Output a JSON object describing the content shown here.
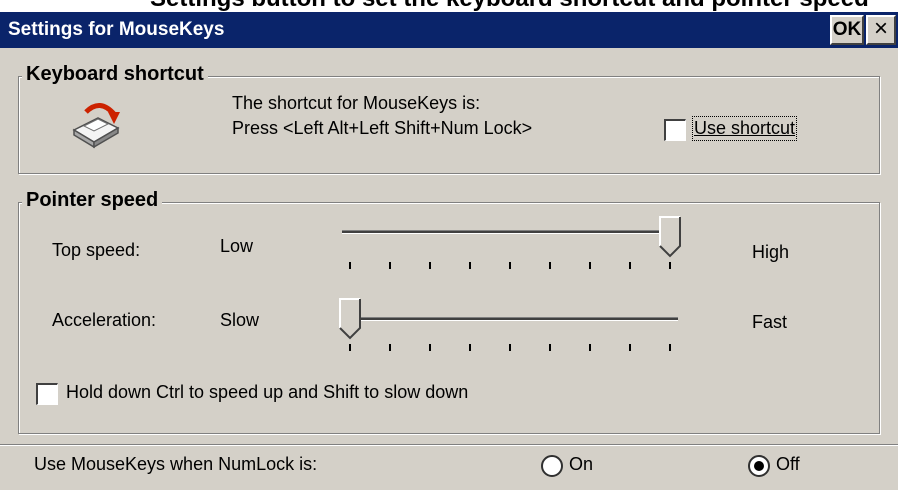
{
  "top_strip": {
    "text": "Settings button to set the keyboard shortcut and pointer speed"
  },
  "title_bar": {
    "title": "Settings for MouseKeys",
    "ok_label": "OK",
    "close_label": "×"
  },
  "keyboard_shortcut": {
    "legend": "Keyboard shortcut",
    "line1": "The shortcut for MouseKeys is:",
    "line2": "Press <Left Alt+Left Shift+Num Lock>",
    "checkbox_label": "Use shortcut",
    "checkbox_checked": false
  },
  "pointer_speed": {
    "legend": "Pointer speed",
    "top_speed": {
      "label": "Top speed:",
      "min_label": "Low",
      "max_label": "High",
      "value_fraction": 1.0
    },
    "acceleration": {
      "label": "Acceleration:",
      "min_label": "Slow",
      "max_label": "Fast",
      "value_fraction": 0.0
    },
    "hold_ctrl_label": "Hold down Ctrl to speed up and Shift to slow down",
    "hold_ctrl_checked": false
  },
  "numlock": {
    "label": "Use MouseKeys when NumLock is:",
    "options": [
      {
        "label": "On",
        "selected": false
      },
      {
        "label": "Off",
        "selected": true
      }
    ]
  },
  "colors": {
    "title_bar": "#0a246a",
    "face": "#d4d0c8",
    "shortcut_arrow": "#cc2200"
  }
}
